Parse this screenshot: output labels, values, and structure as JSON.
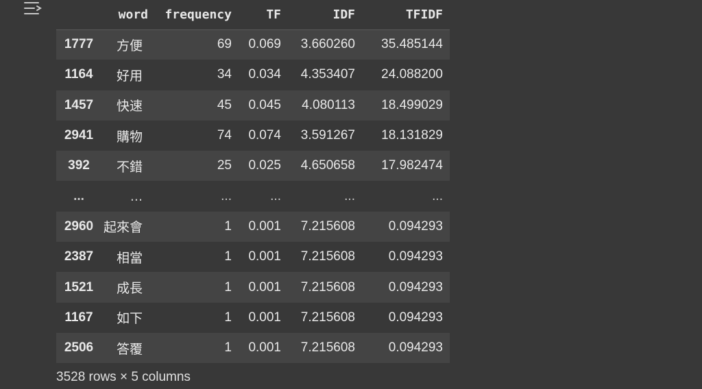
{
  "dataframe": {
    "columns": [
      "",
      "word",
      "frequency",
      "TF",
      "IDF",
      "TFIDF"
    ],
    "rows": [
      {
        "index": "1777",
        "word": "方便",
        "frequency": "69",
        "TF": "0.069",
        "IDF": "3.660260",
        "TFIDF": "35.485144"
      },
      {
        "index": "1164",
        "word": "好用",
        "frequency": "34",
        "TF": "0.034",
        "IDF": "4.353407",
        "TFIDF": "24.088200"
      },
      {
        "index": "1457",
        "word": "快速",
        "frequency": "45",
        "TF": "0.045",
        "IDF": "4.080113",
        "TFIDF": "18.499029"
      },
      {
        "index": "2941",
        "word": "購物",
        "frequency": "74",
        "TF": "0.074",
        "IDF": "3.591267",
        "TFIDF": "18.131829"
      },
      {
        "index": "392",
        "word": "不錯",
        "frequency": "25",
        "TF": "0.025",
        "IDF": "4.650658",
        "TFIDF": "17.982474"
      },
      {
        "index": "...",
        "word": "...",
        "frequency": "...",
        "TF": "...",
        "IDF": "...",
        "TFIDF": "..."
      },
      {
        "index": "2960",
        "word": "起來會",
        "frequency": "1",
        "TF": "0.001",
        "IDF": "7.215608",
        "TFIDF": "0.094293"
      },
      {
        "index": "2387",
        "word": "相當",
        "frequency": "1",
        "TF": "0.001",
        "IDF": "7.215608",
        "TFIDF": "0.094293"
      },
      {
        "index": "1521",
        "word": "成長",
        "frequency": "1",
        "TF": "0.001",
        "IDF": "7.215608",
        "TFIDF": "0.094293"
      },
      {
        "index": "1167",
        "word": "如下",
        "frequency": "1",
        "TF": "0.001",
        "IDF": "7.215608",
        "TFIDF": "0.094293"
      },
      {
        "index": "2506",
        "word": "答覆",
        "frequency": "1",
        "TF": "0.001",
        "IDF": "7.215608",
        "TFIDF": "0.094293"
      }
    ],
    "shape_text": "3528 rows × 5 columns"
  },
  "toolbar": {
    "icon": "output-actions-icon"
  },
  "colors": {
    "background": "#383838",
    "row_stripe": "#444444",
    "text": "#e8e8e8"
  }
}
